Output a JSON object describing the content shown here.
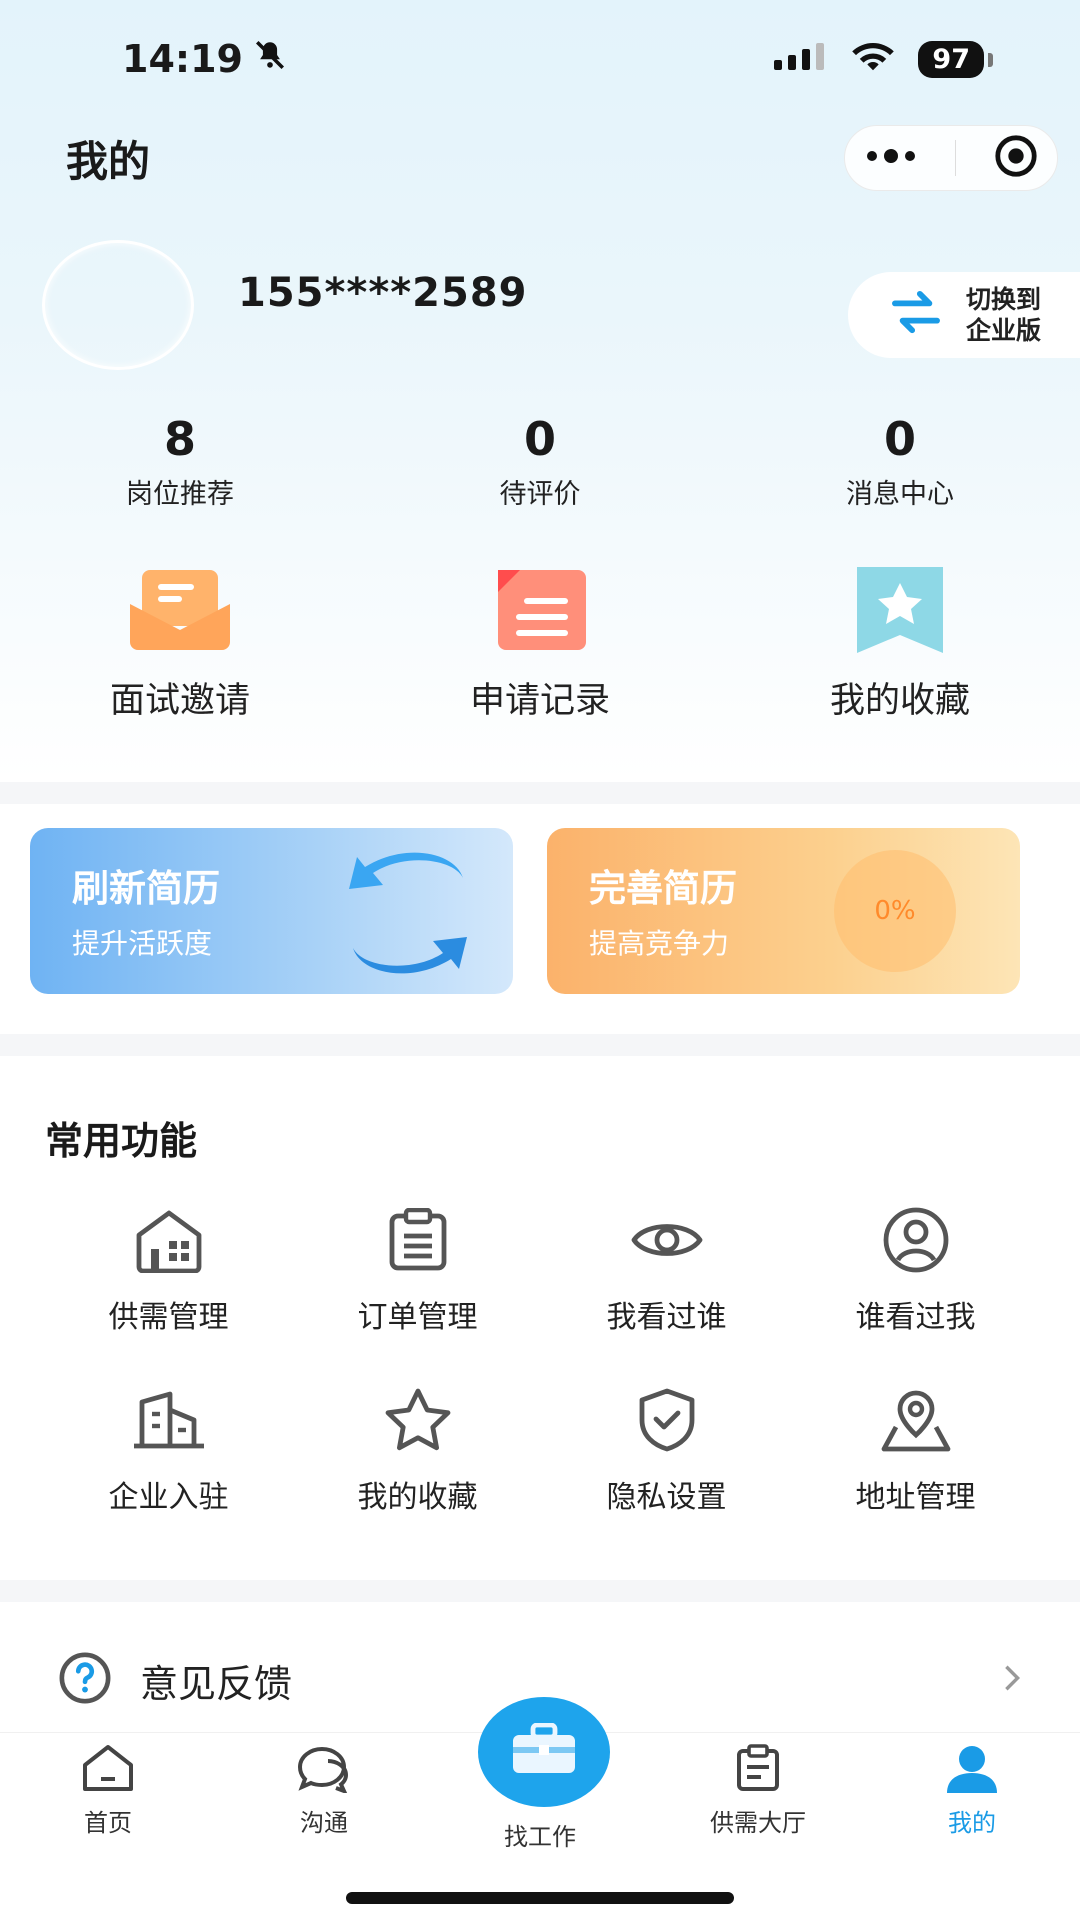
{
  "status_bar": {
    "time": "14:19",
    "battery": "97"
  },
  "header": {
    "title": "我的"
  },
  "profile": {
    "phone": "155****2589",
    "switch_label_line1": "切换到",
    "switch_label_line2": "企业版"
  },
  "stats": [
    {
      "value": "8",
      "label": "岗位推荐"
    },
    {
      "value": "0",
      "label": "待评价"
    },
    {
      "value": "0",
      "label": "消息中心"
    }
  ],
  "quick_actions": [
    {
      "label": "面试邀请",
      "icon": "mail-open-icon"
    },
    {
      "label": "申请记录",
      "icon": "document-icon"
    },
    {
      "label": "我的收藏",
      "icon": "bookmark-star-icon"
    }
  ],
  "cards": {
    "refresh": {
      "title": "刷新简历",
      "subtitle": "提升活跃度"
    },
    "complete": {
      "title": "完善简历",
      "subtitle": "提高竞争力",
      "progress": "0%"
    }
  },
  "common": {
    "title": "常用功能",
    "items": [
      {
        "label": "供需管理",
        "icon": "house-icon"
      },
      {
        "label": "订单管理",
        "icon": "clipboard-icon"
      },
      {
        "label": "我看过谁",
        "icon": "eye-icon"
      },
      {
        "label": "谁看过我",
        "icon": "user-circle-icon"
      },
      {
        "label": "企业入驻",
        "icon": "building-icon"
      },
      {
        "label": "我的收藏",
        "icon": "star-icon"
      },
      {
        "label": "隐私设置",
        "icon": "shield-check-icon"
      },
      {
        "label": "地址管理",
        "icon": "map-pin-icon"
      }
    ]
  },
  "feedback": {
    "label": "意见反馈"
  },
  "tabbar": {
    "items": [
      {
        "label": "首页",
        "icon": "home-icon"
      },
      {
        "label": "沟通",
        "icon": "chat-icon"
      },
      {
        "label": "找工作",
        "icon": "briefcase-icon"
      },
      {
        "label": "供需大厅",
        "icon": "board-icon"
      },
      {
        "label": "我的",
        "icon": "person-icon",
        "active": true
      }
    ]
  },
  "colors": {
    "accent": "#1ea4ec",
    "orange": "#fbb26b",
    "blue": "#6fb3f3"
  }
}
